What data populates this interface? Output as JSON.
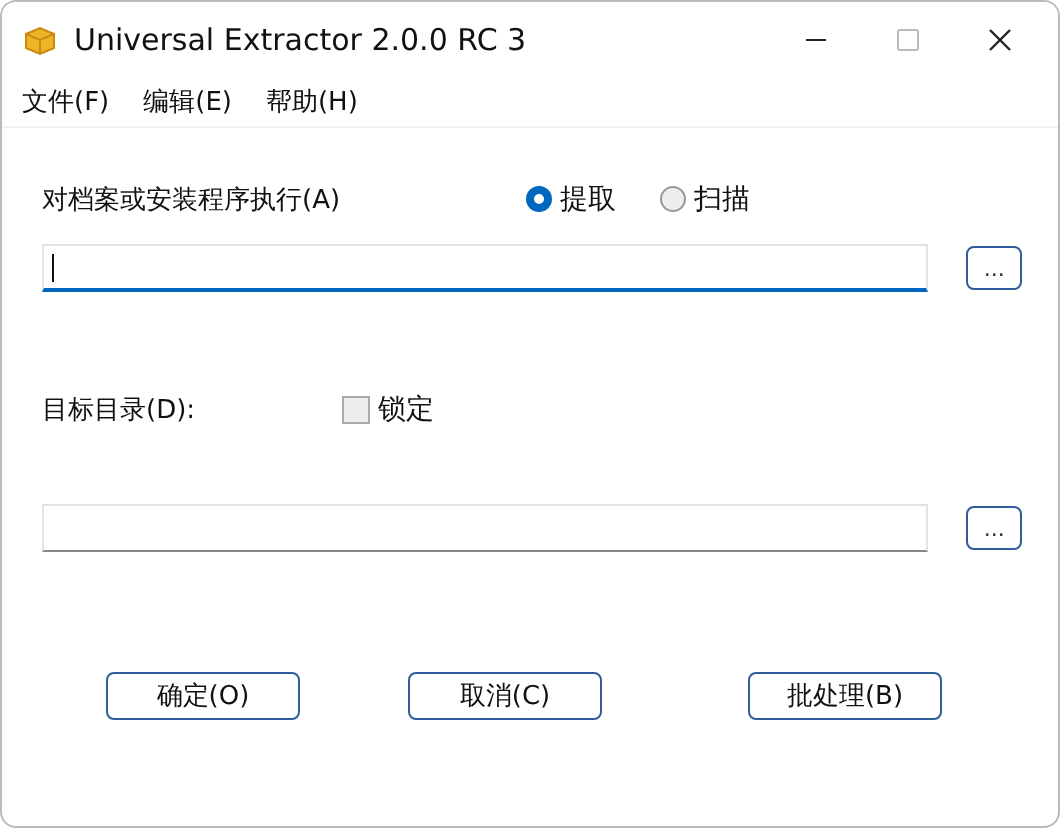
{
  "window": {
    "title": "Universal Extractor 2.0.0 RC 3"
  },
  "menu": [
    "文件(F)",
    "编辑(E)",
    "帮助(H)"
  ],
  "source": {
    "label": "对档案或安装程序执行(A)",
    "modes": [
      {
        "label": "提取",
        "selected": true
      },
      {
        "label": "扫描",
        "selected": false
      }
    ],
    "field": {
      "focused": true
    },
    "browse": "..."
  },
  "destination": {
    "label": "目标目录(D):",
    "lock": {
      "label": "锁定",
      "checked": false
    },
    "field": {
      "focused": false
    },
    "browse": "..."
  },
  "buttons": [
    "确定(O)",
    "取消(C)",
    "批处理(B)"
  ]
}
